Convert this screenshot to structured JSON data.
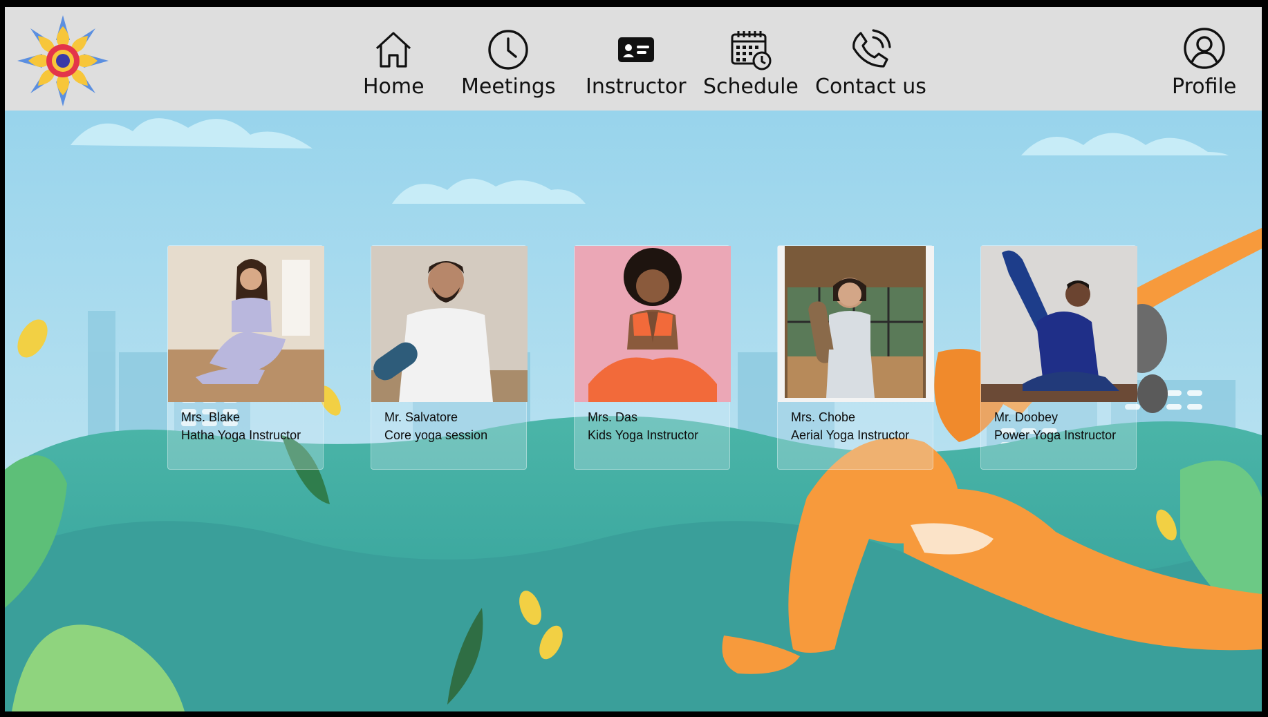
{
  "nav": {
    "items": [
      {
        "label": "Home",
        "icon": "home-icon"
      },
      {
        "label": "Meetings",
        "icon": "clock-icon"
      },
      {
        "label": "Instructor",
        "icon": "id-card-icon"
      },
      {
        "label": "Schedule",
        "icon": "calendar-clock-icon"
      },
      {
        "label": "Contact us",
        "icon": "phone-icon"
      }
    ],
    "profile_label": "Profile",
    "logo_icon": "flower-mandala-logo"
  },
  "instructors": [
    {
      "name": "Mrs. Blake",
      "role": "Hatha Yoga Instructor",
      "photo_bg": "#d9cdbf",
      "accent": "#b9b7dd"
    },
    {
      "name": "Mr. Salvatore",
      "role": "Core yoga session",
      "photo_bg": "#cfc6bb",
      "accent": "#f2f2f2"
    },
    {
      "name": "Mrs. Das",
      "role": "Kids Yoga Instructor",
      "photo_bg": "#eba7b6",
      "accent": "#f26a3a"
    },
    {
      "name": "Mrs. Chobe",
      "role": "Aerial Yoga Instructor",
      "photo_bg": "#8a6a4a",
      "accent": "#d8dde2"
    },
    {
      "name": "Mr. Doobey",
      "role": "Power Yoga Instructor",
      "photo_bg": "#d6d4d2",
      "accent": "#1d3d8a"
    }
  ],
  "colors": {
    "navbar": "#dedede",
    "sky": "#a9dcef",
    "hill": "#3fa7a0",
    "figure": "#f79a3c"
  }
}
